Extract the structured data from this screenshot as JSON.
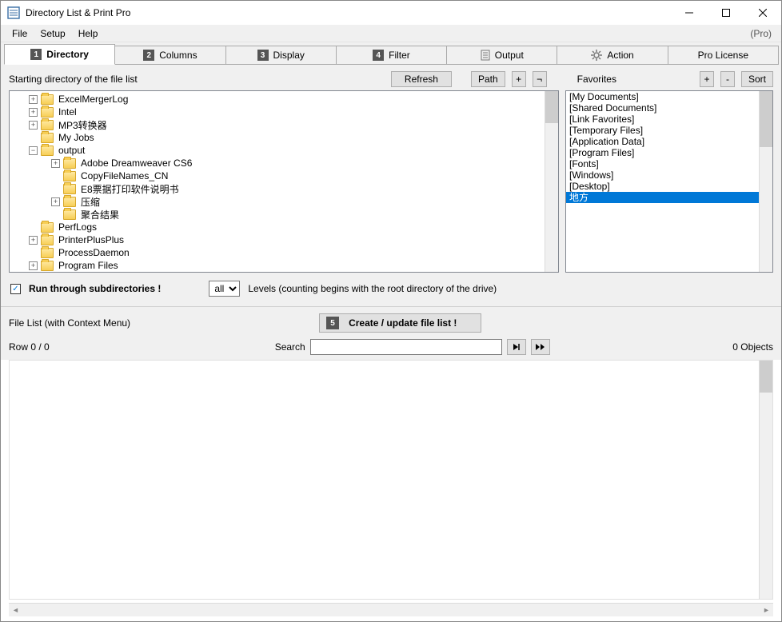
{
  "window": {
    "title": "Directory List & Print Pro",
    "pro_label": "(Pro)"
  },
  "menu": {
    "file": "File",
    "setup": "Setup",
    "help": "Help"
  },
  "tabs": [
    {
      "num": "1",
      "label": "Directory",
      "active": true
    },
    {
      "num": "2",
      "label": "Columns"
    },
    {
      "num": "3",
      "label": "Display"
    },
    {
      "num": "4",
      "label": "Filter"
    },
    {
      "num": "",
      "label": "Output",
      "icon": "doc"
    },
    {
      "num": "",
      "label": "Action",
      "icon": "gear"
    },
    {
      "num": "",
      "label": "Pro License"
    }
  ],
  "directory": {
    "starting_label": "Starting directory of the file list",
    "refresh": "Refresh",
    "path": "Path",
    "plus": "+",
    "neg": "¬"
  },
  "tree": [
    {
      "level": 1,
      "exp": "+",
      "label": "ExcelMergerLog"
    },
    {
      "level": 1,
      "exp": "+",
      "label": "Intel"
    },
    {
      "level": 1,
      "exp": "+",
      "label": "MP3转换器"
    },
    {
      "level": 1,
      "exp": " ",
      "label": "My Jobs"
    },
    {
      "level": 1,
      "exp": "-",
      "label": "output"
    },
    {
      "level": 2,
      "exp": "+",
      "label": "Adobe Dreamweaver CS6"
    },
    {
      "level": 2,
      "exp": " ",
      "label": "CopyFileNames_CN"
    },
    {
      "level": 2,
      "exp": " ",
      "label": "E8票据打印软件说明书"
    },
    {
      "level": 2,
      "exp": "+",
      "label": "压缩"
    },
    {
      "level": 2,
      "exp": " ",
      "label": "聚合结果"
    },
    {
      "level": 1,
      "exp": " ",
      "label": "PerfLogs"
    },
    {
      "level": 1,
      "exp": "+",
      "label": "PrinterPlusPlus"
    },
    {
      "level": 1,
      "exp": " ",
      "label": "ProcessDaemon"
    },
    {
      "level": 1,
      "exp": "+",
      "label": "Program Files"
    }
  ],
  "favorites": {
    "label": "Favorites",
    "add": "+",
    "remove": "-",
    "sort": "Sort",
    "items": [
      {
        "label": "[My Documents]"
      },
      {
        "label": "[Shared Documents]"
      },
      {
        "label": "[Link Favorites]"
      },
      {
        "label": "[Temporary Files]"
      },
      {
        "label": "[Application Data]"
      },
      {
        "label": "[Program Files]"
      },
      {
        "label": "[Fonts]"
      },
      {
        "label": "[Windows]"
      },
      {
        "label": "[Desktop]"
      },
      {
        "label": "地方",
        "selected": true
      }
    ]
  },
  "run": {
    "checked": true,
    "label": "Run through subdirectories !",
    "level_select": "all",
    "level_suffix": "Levels  (counting begins with the root directory of the drive)"
  },
  "filelist": {
    "context_label": "File List (with Context Menu)",
    "create_num": "5",
    "create_label": "Create / update file list !"
  },
  "search": {
    "row_label": "Row 0 / 0",
    "search_label": "Search",
    "value": "",
    "next": "▶|",
    "next2": "▶▶",
    "objects": "0 Objects"
  }
}
